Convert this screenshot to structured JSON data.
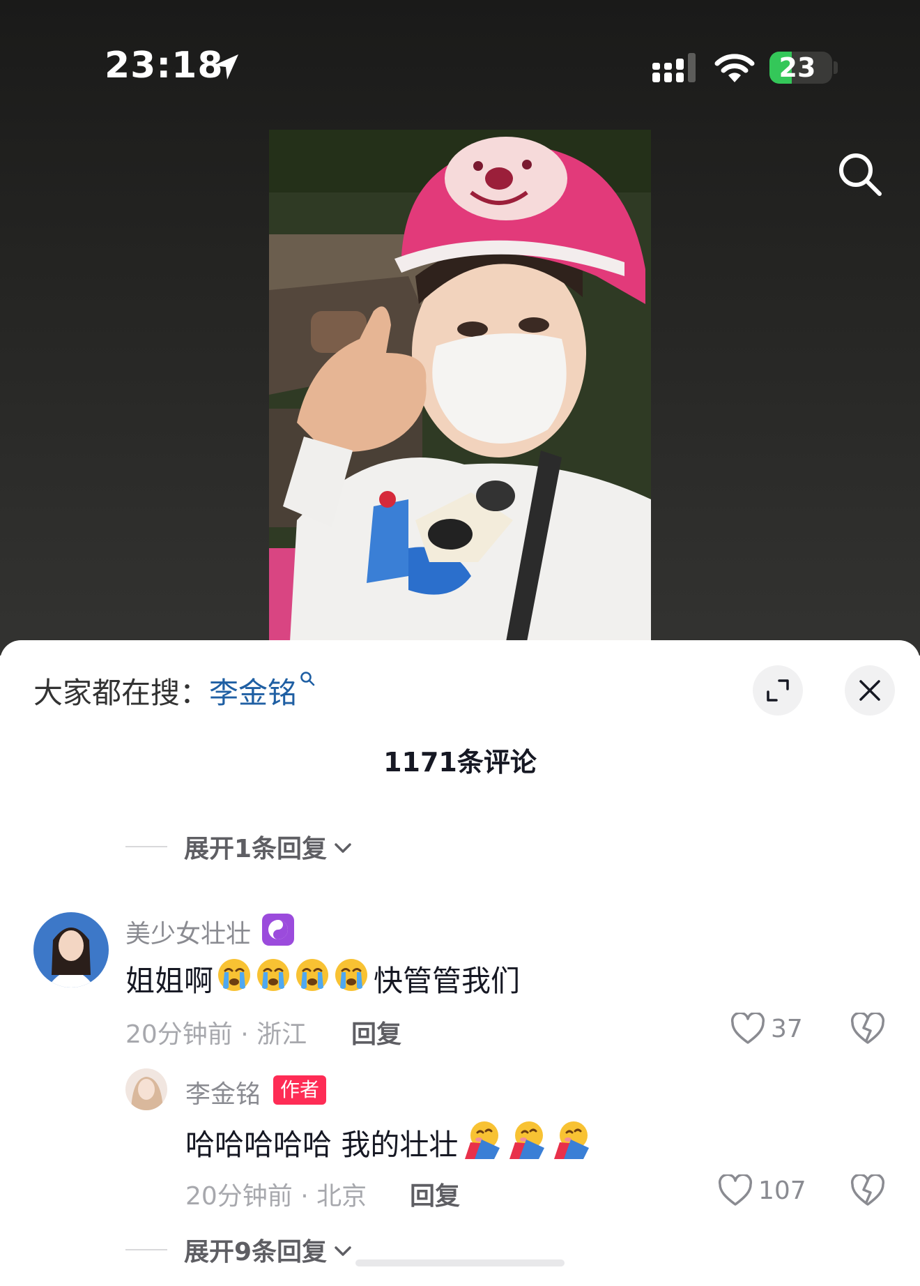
{
  "status_bar": {
    "time": "23:18",
    "battery_percent": "23"
  },
  "search_hint": {
    "prefix": "大家都在搜：",
    "keyword": "李金铭"
  },
  "comments_header": {
    "count_label": "1171条评论"
  },
  "top_expand": {
    "label": "展开1条回复"
  },
  "comments": [
    {
      "username": "美少女壮壮",
      "text_before": "姐姐啊",
      "emoji_count": 4,
      "text_after": "快管管我们",
      "time": "20分钟前 · 浙江",
      "reply_label": "回复",
      "likes": "37"
    }
  ],
  "replies": [
    {
      "username": "李金铭",
      "badge": "作者",
      "text": "哈哈哈哈哈 我的壮壮",
      "time": "20分钟前 · 北京",
      "reply_label": "回复",
      "likes": "107"
    }
  ],
  "bottom_expand": {
    "label": "展开9条回复"
  },
  "colors": {
    "accent_link": "#1f5fa3",
    "author_badge": "#fe2c55",
    "helmet_pink": "#e23a7a"
  }
}
